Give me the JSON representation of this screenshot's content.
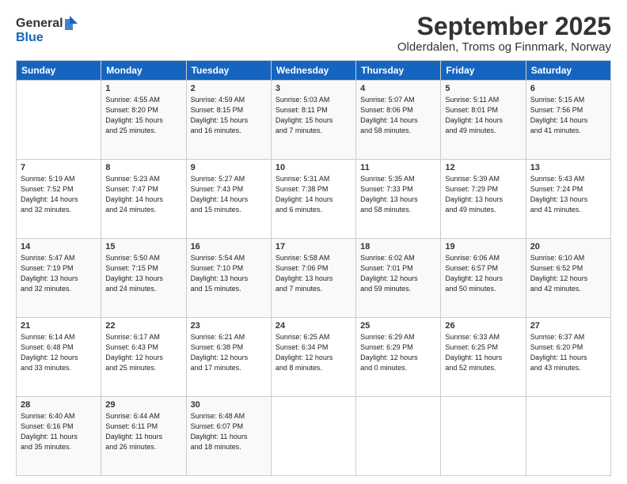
{
  "logo": {
    "line1": "General",
    "line2": "Blue"
  },
  "title": "September 2025",
  "subtitle": "Olderdalen, Troms og Finnmark, Norway",
  "headers": [
    "Sunday",
    "Monday",
    "Tuesday",
    "Wednesday",
    "Thursday",
    "Friday",
    "Saturday"
  ],
  "weeks": [
    [
      {
        "day": "",
        "info": ""
      },
      {
        "day": "1",
        "info": "Sunrise: 4:55 AM\nSunset: 8:20 PM\nDaylight: 15 hours\nand 25 minutes."
      },
      {
        "day": "2",
        "info": "Sunrise: 4:59 AM\nSunset: 8:15 PM\nDaylight: 15 hours\nand 16 minutes."
      },
      {
        "day": "3",
        "info": "Sunrise: 5:03 AM\nSunset: 8:11 PM\nDaylight: 15 hours\nand 7 minutes."
      },
      {
        "day": "4",
        "info": "Sunrise: 5:07 AM\nSunset: 8:06 PM\nDaylight: 14 hours\nand 58 minutes."
      },
      {
        "day": "5",
        "info": "Sunrise: 5:11 AM\nSunset: 8:01 PM\nDaylight: 14 hours\nand 49 minutes."
      },
      {
        "day": "6",
        "info": "Sunrise: 5:15 AM\nSunset: 7:56 PM\nDaylight: 14 hours\nand 41 minutes."
      }
    ],
    [
      {
        "day": "7",
        "info": "Sunrise: 5:19 AM\nSunset: 7:52 PM\nDaylight: 14 hours\nand 32 minutes."
      },
      {
        "day": "8",
        "info": "Sunrise: 5:23 AM\nSunset: 7:47 PM\nDaylight: 14 hours\nand 24 minutes."
      },
      {
        "day": "9",
        "info": "Sunrise: 5:27 AM\nSunset: 7:43 PM\nDaylight: 14 hours\nand 15 minutes."
      },
      {
        "day": "10",
        "info": "Sunrise: 5:31 AM\nSunset: 7:38 PM\nDaylight: 14 hours\nand 6 minutes."
      },
      {
        "day": "11",
        "info": "Sunrise: 5:35 AM\nSunset: 7:33 PM\nDaylight: 13 hours\nand 58 minutes."
      },
      {
        "day": "12",
        "info": "Sunrise: 5:39 AM\nSunset: 7:29 PM\nDaylight: 13 hours\nand 49 minutes."
      },
      {
        "day": "13",
        "info": "Sunrise: 5:43 AM\nSunset: 7:24 PM\nDaylight: 13 hours\nand 41 minutes."
      }
    ],
    [
      {
        "day": "14",
        "info": "Sunrise: 5:47 AM\nSunset: 7:19 PM\nDaylight: 13 hours\nand 32 minutes."
      },
      {
        "day": "15",
        "info": "Sunrise: 5:50 AM\nSunset: 7:15 PM\nDaylight: 13 hours\nand 24 minutes."
      },
      {
        "day": "16",
        "info": "Sunrise: 5:54 AM\nSunset: 7:10 PM\nDaylight: 13 hours\nand 15 minutes."
      },
      {
        "day": "17",
        "info": "Sunrise: 5:58 AM\nSunset: 7:06 PM\nDaylight: 13 hours\nand 7 minutes."
      },
      {
        "day": "18",
        "info": "Sunrise: 6:02 AM\nSunset: 7:01 PM\nDaylight: 12 hours\nand 59 minutes."
      },
      {
        "day": "19",
        "info": "Sunrise: 6:06 AM\nSunset: 6:57 PM\nDaylight: 12 hours\nand 50 minutes."
      },
      {
        "day": "20",
        "info": "Sunrise: 6:10 AM\nSunset: 6:52 PM\nDaylight: 12 hours\nand 42 minutes."
      }
    ],
    [
      {
        "day": "21",
        "info": "Sunrise: 6:14 AM\nSunset: 6:48 PM\nDaylight: 12 hours\nand 33 minutes."
      },
      {
        "day": "22",
        "info": "Sunrise: 6:17 AM\nSunset: 6:43 PM\nDaylight: 12 hours\nand 25 minutes."
      },
      {
        "day": "23",
        "info": "Sunrise: 6:21 AM\nSunset: 6:38 PM\nDaylight: 12 hours\nand 17 minutes."
      },
      {
        "day": "24",
        "info": "Sunrise: 6:25 AM\nSunset: 6:34 PM\nDaylight: 12 hours\nand 8 minutes."
      },
      {
        "day": "25",
        "info": "Sunrise: 6:29 AM\nSunset: 6:29 PM\nDaylight: 12 hours\nand 0 minutes."
      },
      {
        "day": "26",
        "info": "Sunrise: 6:33 AM\nSunset: 6:25 PM\nDaylight: 11 hours\nand 52 minutes."
      },
      {
        "day": "27",
        "info": "Sunrise: 6:37 AM\nSunset: 6:20 PM\nDaylight: 11 hours\nand 43 minutes."
      }
    ],
    [
      {
        "day": "28",
        "info": "Sunrise: 6:40 AM\nSunset: 6:16 PM\nDaylight: 11 hours\nand 35 minutes."
      },
      {
        "day": "29",
        "info": "Sunrise: 6:44 AM\nSunset: 6:11 PM\nDaylight: 11 hours\nand 26 minutes."
      },
      {
        "day": "30",
        "info": "Sunrise: 6:48 AM\nSunset: 6:07 PM\nDaylight: 11 hours\nand 18 minutes."
      },
      {
        "day": "",
        "info": ""
      },
      {
        "day": "",
        "info": ""
      },
      {
        "day": "",
        "info": ""
      },
      {
        "day": "",
        "info": ""
      }
    ]
  ]
}
